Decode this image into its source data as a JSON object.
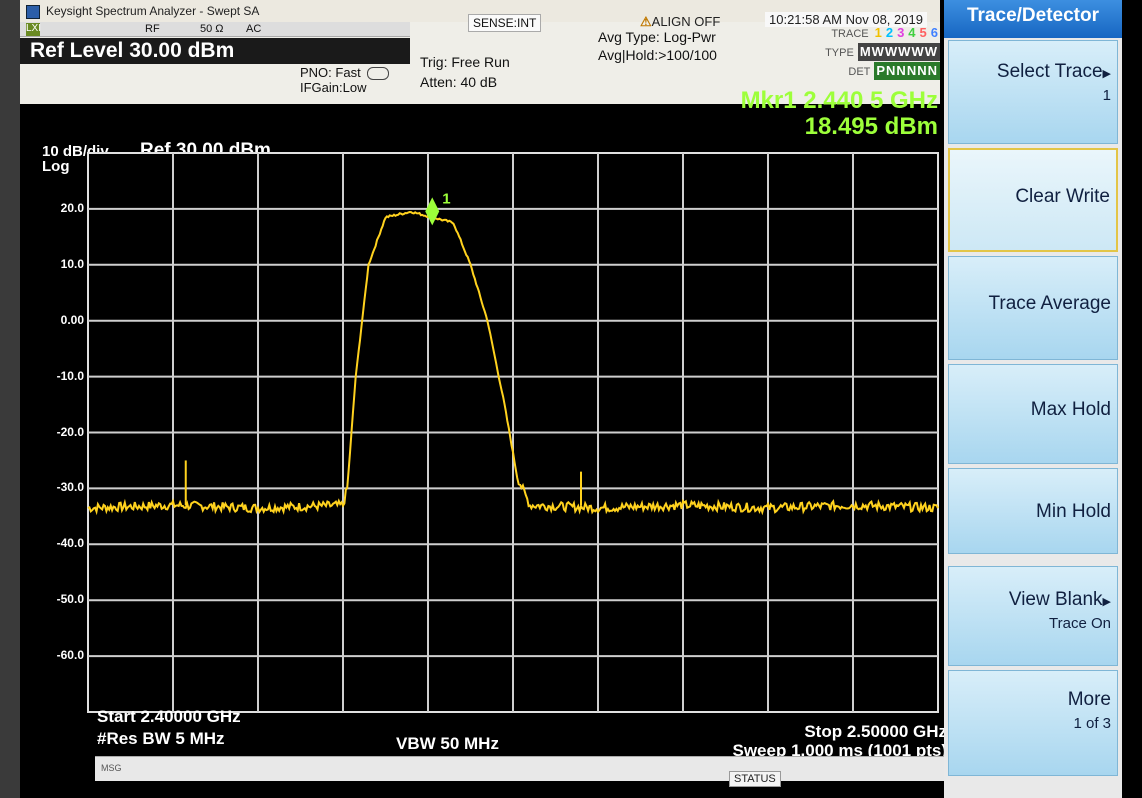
{
  "window": {
    "title": "Keysight Spectrum Analyzer - Swept SA"
  },
  "topstrip": {
    "mode": "LXI",
    "rf": "RF",
    "impedance": "50 Ω",
    "coupling": "AC"
  },
  "header": {
    "ref_level": "Ref Level 30.00 dBm",
    "pno": "PNO: Fast",
    "ifgain": "IFGain:Low",
    "trig": "Trig: Free Run",
    "atten": "Atten: 40 dB",
    "sense": "SENSE:INT",
    "align": "ALIGN OFF",
    "avg_type": "Avg Type: Log-Pwr",
    "avg_hold": "Avg|Hold:>100/100",
    "clock": "10:21:58 AM Nov 08, 2019",
    "trace_label": "TRACE",
    "type_label": "TYPE",
    "det_label": "DET",
    "trace_nums": [
      "1",
      "2",
      "3",
      "4",
      "5",
      "6"
    ],
    "trace_colors": [
      "#f0c000",
      "#00c0ff",
      "#e040e0",
      "#40d040",
      "#ff6060",
      "#4080ff"
    ],
    "type_value": "MWWWWW",
    "det_value": "PNNNNN"
  },
  "marker": {
    "line1": "Mkr1 2.440 5 GHz",
    "line2": "18.495 dBm",
    "label": "1"
  },
  "plot": {
    "scale_line1": "10 dB/div",
    "scale_line2": "Log",
    "ref": "Ref 30.00 dBm",
    "y_ticks": [
      "20.0",
      "10.0",
      "0.00",
      "-10.0",
      "-20.0",
      "-30.0",
      "-40.0",
      "-50.0",
      "-60.0"
    ],
    "start": "Start 2.40000 GHz",
    "res_bw": "#Res BW 5 MHz",
    "vbw": "VBW 50 MHz",
    "stop": "Stop 2.50000 GHz",
    "sweep": "Sweep  1.000 ms (1001 pts)",
    "trace_color": "#ffd21e"
  },
  "chart_data": {
    "type": "line",
    "title": "",
    "xlabel": "",
    "ylabel": "",
    "x_unit": "GHz",
    "y_unit": "dBm",
    "xlim": [
      2.4,
      2.5
    ],
    "ylim": [
      -70,
      30
    ],
    "x": [
      2.4,
      2.41,
      2.42,
      2.43,
      2.4305,
      2.4315,
      2.433,
      2.435,
      2.438,
      2.4405,
      2.443,
      2.445,
      2.447,
      2.449,
      2.4505,
      2.452,
      2.46,
      2.47,
      2.48,
      2.49,
      2.5
    ],
    "series": [
      {
        "values": [
          -33.5,
          -33,
          -33.5,
          -33,
          -30,
          -10,
          10,
          18.5,
          19.5,
          18.5,
          17.5,
          10,
          0,
          -15,
          -28,
          -33,
          -33.5,
          -33,
          -33.5,
          -33,
          -33.5
        ]
      }
    ],
    "spurs": [
      {
        "x": 2.4115,
        "y": -25
      },
      {
        "x": 2.458,
        "y": -27
      }
    ],
    "marker": {
      "x": 2.4405,
      "y": 18.495,
      "label": "1"
    }
  },
  "status": {
    "msg": "MSG",
    "status": "STATUS"
  },
  "softkeys": {
    "title": "Trace/Detector",
    "items": [
      {
        "label": "Select Trace",
        "sub": "1"
      },
      {
        "label": "Clear Write",
        "sub": ""
      },
      {
        "label": "Trace Average",
        "sub": ""
      },
      {
        "label": "Max Hold",
        "sub": ""
      },
      {
        "label": "Min Hold",
        "sub": ""
      },
      {
        "label": "View Blank",
        "sub": "Trace On"
      },
      {
        "label": "More",
        "sub": "1 of 3"
      }
    ]
  }
}
